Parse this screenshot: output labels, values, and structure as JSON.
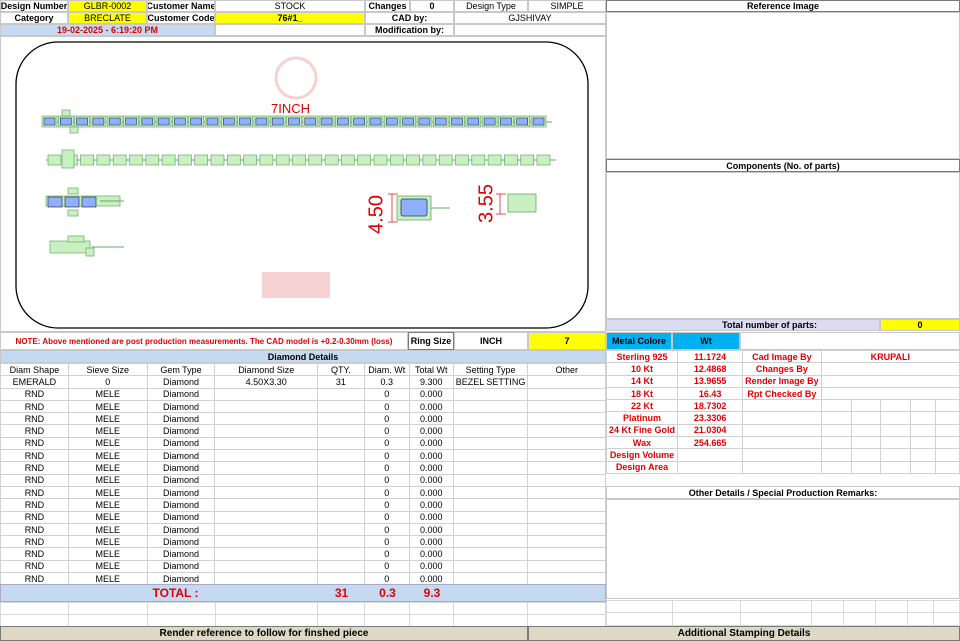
{
  "header": {
    "design_number_label": "Design Number",
    "design_number": "GLBR-0002",
    "customer_name_label": "Customer Name",
    "customer_name": "STOCK",
    "changes_label": "Changes",
    "changes": "0",
    "design_type_label": "Design Type",
    "design_type": "SIMPLE",
    "category_label": "Category",
    "category": "BRECLATE",
    "customer_code_label": "Customer Code",
    "customer_code": "76#1_",
    "cad_by_label": "CAD by:",
    "cad_by": "GJSHIVAY",
    "timestamp": "19-02-2025 - 6:19:20 PM",
    "modification_label": "Modification by:"
  },
  "right_panel": {
    "reference_image": "Reference Image",
    "components": "Components (No. of parts)",
    "total_parts_label": "Total number of parts:",
    "total_parts": "0"
  },
  "cad": {
    "length_label": "7INCH",
    "dim1": "4.50",
    "dim2": "3.55"
  },
  "note": {
    "text": "NOTE: Above mentioned are post production measurements. The CAD model is +0.2-0.30mm (loss)",
    "ring_size_label": "Ring Size",
    "unit": "INCH",
    "value": "7"
  },
  "diamond": {
    "title": "Diamond Details",
    "columns": [
      "Diam Shape",
      "Sieve Size",
      "Gem Type",
      "Diamond Size",
      "QTY.",
      "Diam. Wt",
      "Total Wt",
      "Setting Type",
      "Other"
    ],
    "rows": [
      [
        "EMERALD",
        "0",
        "Diamond",
        "4.50X3.30",
        "31",
        "0.3",
        "9.300",
        "BEZEL SETTING",
        ""
      ],
      [
        "RND",
        "MELE",
        "Diamond",
        "",
        "",
        "0",
        "0.000",
        "",
        ""
      ],
      [
        "RND",
        "MELE",
        "Diamond",
        "",
        "",
        "0",
        "0.000",
        "",
        ""
      ],
      [
        "RND",
        "MELE",
        "Diamond",
        "",
        "",
        "0",
        "0.000",
        "",
        ""
      ],
      [
        "RND",
        "MELE",
        "Diamond",
        "",
        "",
        "0",
        "0.000",
        "",
        ""
      ],
      [
        "RND",
        "MELE",
        "Diamond",
        "",
        "",
        "0",
        "0.000",
        "",
        ""
      ],
      [
        "RND",
        "MELE",
        "Diamond",
        "",
        "",
        "0",
        "0.000",
        "",
        ""
      ],
      [
        "RND",
        "MELE",
        "Diamond",
        "",
        "",
        "0",
        "0.000",
        "",
        ""
      ],
      [
        "RND",
        "MELE",
        "Diamond",
        "",
        "",
        "0",
        "0.000",
        "",
        ""
      ],
      [
        "RND",
        "MELE",
        "Diamond",
        "",
        "",
        "0",
        "0.000",
        "",
        ""
      ],
      [
        "RND",
        "MELE",
        "Diamond",
        "",
        "",
        "0",
        "0.000",
        "",
        ""
      ],
      [
        "RND",
        "MELE",
        "Diamond",
        "",
        "",
        "0",
        "0.000",
        "",
        ""
      ],
      [
        "RND",
        "MELE",
        "Diamond",
        "",
        "",
        "0",
        "0.000",
        "",
        ""
      ],
      [
        "RND",
        "MELE",
        "Diamond",
        "",
        "",
        "0",
        "0.000",
        "",
        ""
      ],
      [
        "RND",
        "MELE",
        "Diamond",
        "",
        "",
        "0",
        "0.000",
        "",
        ""
      ],
      [
        "RND",
        "MELE",
        "Diamond",
        "",
        "",
        "0",
        "0.000",
        "",
        ""
      ],
      [
        "RND",
        "MELE",
        "Diamond",
        "",
        "",
        "0",
        "0.000",
        "",
        ""
      ],
      [
        "RND",
        "MELE",
        "Diamond",
        "",
        "",
        "0",
        "0.000",
        "",
        ""
      ]
    ],
    "total_label": "TOTAL :",
    "total_qty": "31",
    "total_diam_wt": "0.3",
    "total_wt": "9.3"
  },
  "metal": {
    "header_label": "Metal Colore",
    "header_wt": "Wt",
    "rows": [
      {
        "name": "Sterling 925",
        "wt": "11.1724"
      },
      {
        "name": "10 Kt",
        "wt": "12.4868"
      },
      {
        "name": "14 Kt",
        "wt": "13.9655"
      },
      {
        "name": "18 Kt",
        "wt": "16.43"
      },
      {
        "name": "22 Kt",
        "wt": "18.7302"
      },
      {
        "name": "Platinum",
        "wt": "23.3306"
      },
      {
        "name": "24 Kt Fine Gold",
        "wt": "21.0304"
      },
      {
        "name": "Wax",
        "wt": "254.665"
      },
      {
        "name": "Design Volume",
        "wt": ""
      },
      {
        "name": "Design Area",
        "wt": ""
      }
    ],
    "cad_image_by_label": "Cad Image By",
    "cad_image_by": "KRUPALI",
    "changes_by_label": "Changes By",
    "render_image_by_label": "Render Image By",
    "rpt_checked_by_label": "Rpt Checked By"
  },
  "other_details": "Other Details / Special Production Remarks:",
  "footer": {
    "render_reference": "Render reference to follow for finshed piece",
    "stamping": "Additional Stamping Details"
  }
}
